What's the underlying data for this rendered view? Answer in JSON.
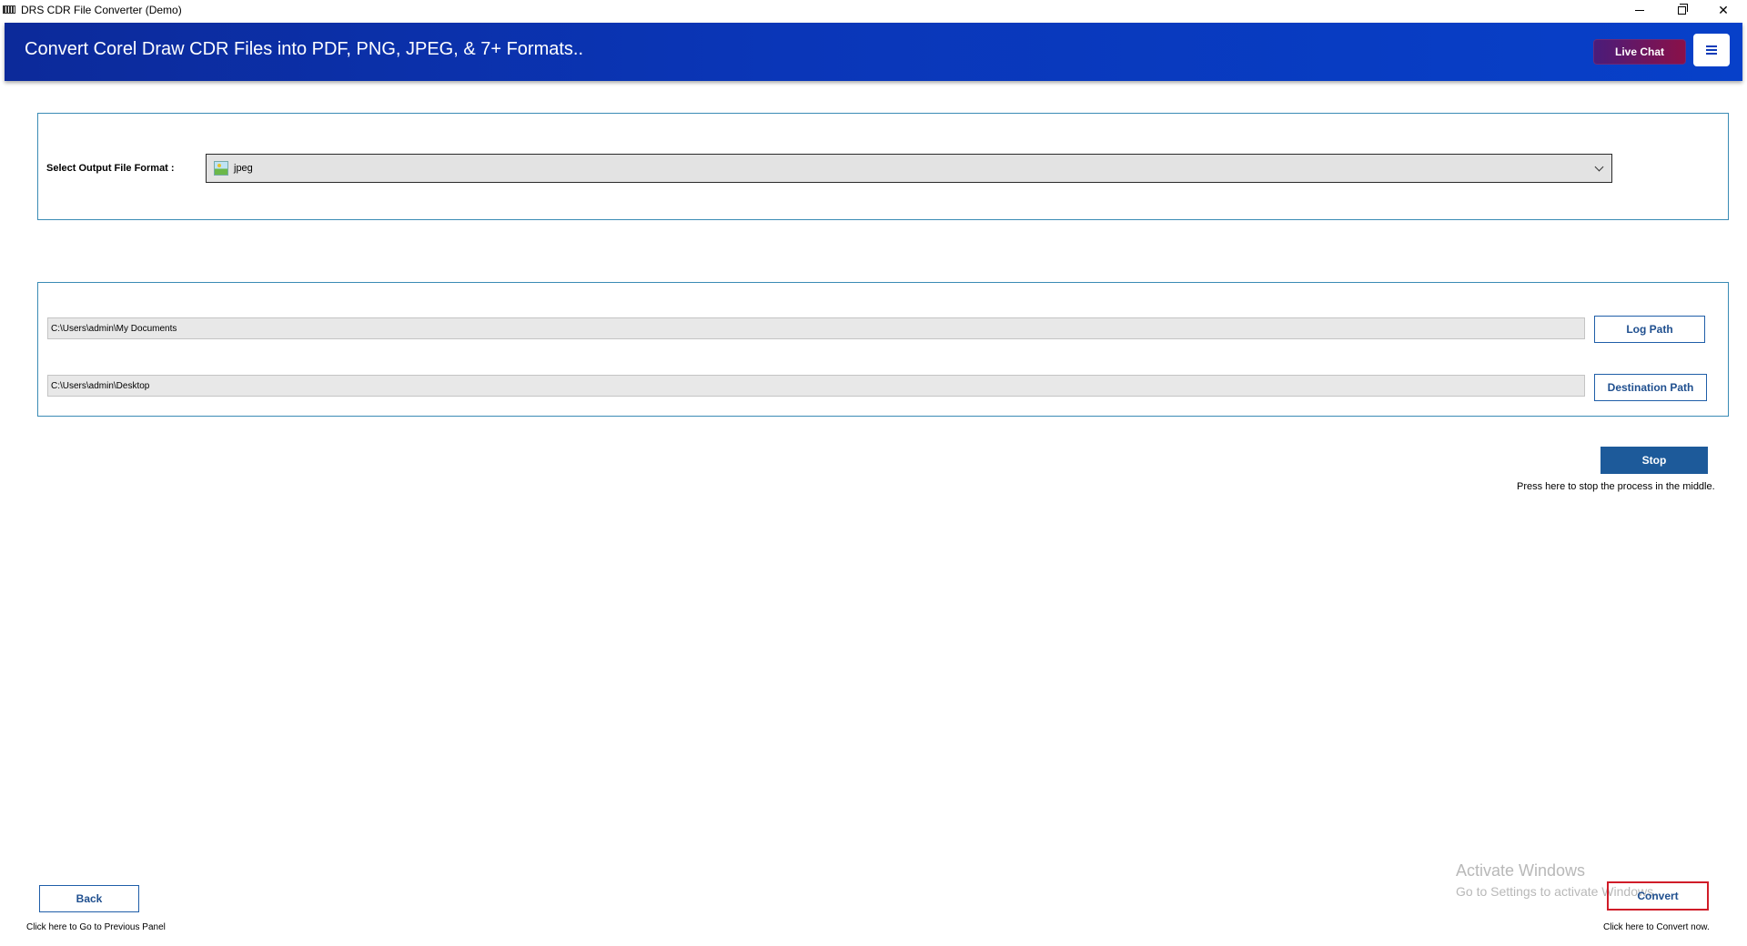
{
  "window": {
    "title": "DRS CDR File Converter (Demo)",
    "minimize_icon": "minimize-icon",
    "maximize_icon": "restore-icon",
    "close_glyph": "✕"
  },
  "header": {
    "title": "Convert Corel Draw CDR Files into PDF, PNG, JPEG, & 7+ Formats..",
    "live_chat_label": "Live Chat",
    "menu_icon": "hamburger-menu-icon"
  },
  "format_panel": {
    "label": "Select Output File Format :",
    "selected_value": "jpeg",
    "selected_icon": "image-file-icon"
  },
  "paths_panel": {
    "log_path_value": "C:\\Users\\admin\\My Documents",
    "log_path_button": "Log Path",
    "destination_path_value": "C:\\Users\\admin\\Desktop",
    "destination_path_button": "Destination Path"
  },
  "stop": {
    "label": "Stop",
    "hint": "Press here to stop the process in the middle."
  },
  "footer": {
    "back_label": "Back",
    "back_hint": "Click here to Go to Previous Panel",
    "convert_label": "Convert",
    "convert_hint": "Click here to Convert now."
  },
  "watermark": {
    "title": "Activate Windows",
    "subtitle": "Go to Settings to activate Windows."
  },
  "colors": {
    "header_gradient_start": "#0c2a9a",
    "header_gradient_end": "#0740c9",
    "button_accent": "#1f5ea8",
    "stop_fill": "#1d5a9a",
    "convert_highlight": "#d01c28"
  }
}
